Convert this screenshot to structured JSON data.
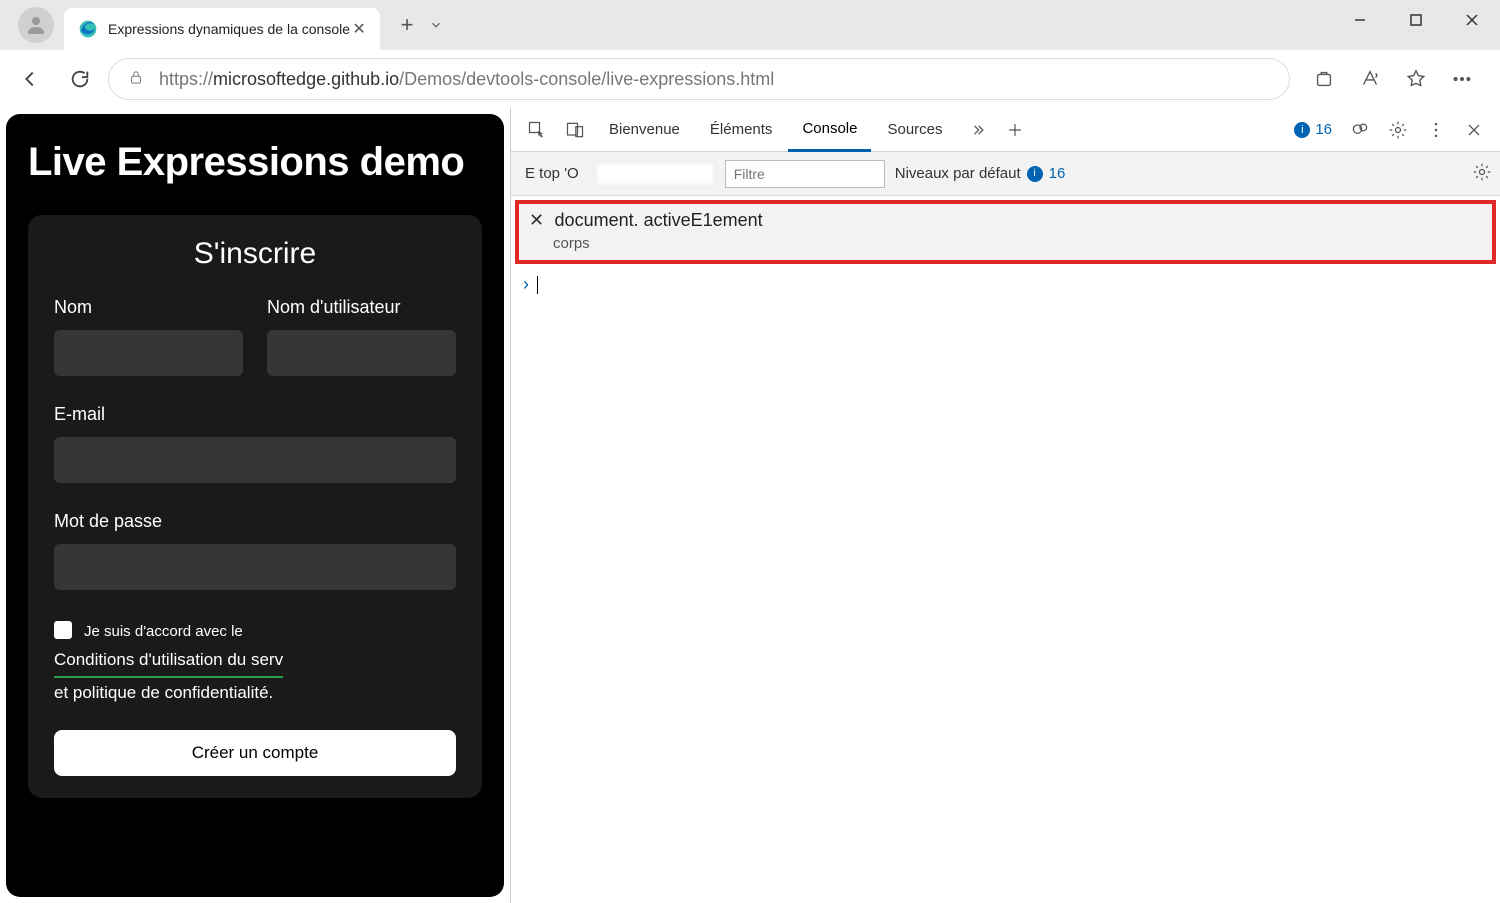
{
  "browser": {
    "tab_title": "Expressions dynamiques de la console",
    "url_prefix": "https://",
    "url_host": "microsoftedge.github.io",
    "url_path": "/Demos/devtools-console/live-expressions.html"
  },
  "page": {
    "title": "Live Expressions demo",
    "form": {
      "heading": "S'inscrire",
      "name_label": "Nom",
      "username_label": "Nom d'utilisateur",
      "email_label": "E-mail",
      "password_label": "Mot de passe",
      "agree_small": "Je suis d'accord avec le",
      "agree_link": "Conditions d'utilisation du serv",
      "agree_rest": "et politique de confidentialité.",
      "submit": "Créer un compte"
    }
  },
  "devtools": {
    "tabs": {
      "welcome": "Bienvenue",
      "elements": "Éléments",
      "console": "Console",
      "sources": "Sources"
    },
    "issues_count": "16",
    "filter": {
      "context": "E top 'O",
      "filter_placeholder": "Filtre",
      "levels": "Niveaux par défaut",
      "levels_count": "16"
    },
    "live_expression": {
      "expression": "document. activeE1ement",
      "value": "corps"
    }
  }
}
